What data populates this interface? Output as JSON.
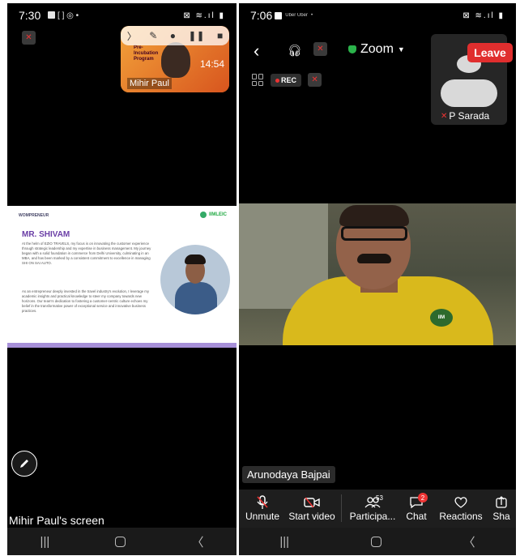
{
  "left_phone": {
    "status_time": "7:30",
    "bubble": {
      "name": "Mihir Paul",
      "timer": "14:54",
      "promo_text": "Pre-Incubation Program"
    },
    "slide": {
      "logo_left": "WOMPRENEUR",
      "logo_right": "IIMLEIC",
      "heading": "MR. SHIVAM",
      "para1": "At the helm of EZIO TRAVELS, my focus is on innovating the customer experience through strategic leadership and my expertise in business management. My journey began with a solid foundation in commerce from Delhi University, culminating in an MBA, and has been marked by a consistent commitment to excellence in managing SHI ON SAI AUTO.",
      "para2": "As an entrepreneur deeply invested in the travel industry's evolution, I leverage my academic insights and practical knowledge to steer my company towards new horizons. Our team's dedication to fostering a customer-centric culture echoes my belief in the transformative power of exceptional service and innovative business practices."
    },
    "screen_label": "Mihir Paul's screen"
  },
  "right_phone": {
    "status_time": "7:06",
    "status_extra": "Uber Uber",
    "meeting_title": "Zoom",
    "leave_label": "Leave",
    "rec_label": "REC",
    "self_name": "P Sarada",
    "speaker_name": "Arunodaya Bajpai",
    "shirt_badge": "IIM",
    "toolbar": {
      "unmute": "Unmute",
      "start_video": "Start video",
      "participants": "Participa...",
      "participants_count": "53",
      "chat": "Chat",
      "chat_count": "2",
      "reactions": "Reactions",
      "share": "Sha"
    }
  },
  "colors": {
    "leave": "#e02e2e",
    "shield": "#2bb34b",
    "slide_heading": "#6a3ea6"
  }
}
